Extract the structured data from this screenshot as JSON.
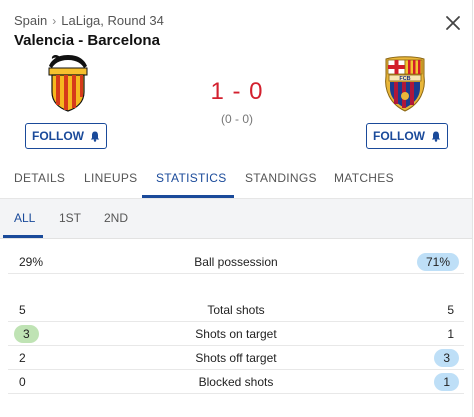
{
  "header": {
    "country": "Spain",
    "separator": "›",
    "competition": "LaLiga, Round 34",
    "title": "Valencia - Barcelona"
  },
  "match": {
    "home_team": "Valencia",
    "away_team": "Barcelona",
    "score": "1 - 0",
    "halftime": "(0 - 0)",
    "follow_label": "FOLLOW",
    "score_color": "#d3202e"
  },
  "tabs": [
    {
      "label": "DETAILS"
    },
    {
      "label": "LINEUPS"
    },
    {
      "label": "STATISTICS",
      "active": true
    },
    {
      "label": "STANDINGS"
    },
    {
      "label": "MATCHES"
    }
  ],
  "subtabs": [
    {
      "label": "ALL",
      "active": true
    },
    {
      "label": "1ST"
    },
    {
      "label": "2ND"
    }
  ],
  "stats": [
    {
      "label": "Ball possession",
      "home": "29%",
      "away": "71%",
      "leader": "away"
    },
    {
      "label": "Total shots",
      "home": "5",
      "away": "5",
      "leader": "none"
    },
    {
      "label": "Shots on target",
      "home": "3",
      "away": "1",
      "leader": "home"
    },
    {
      "label": "Shots off target",
      "home": "2",
      "away": "3",
      "leader": "away"
    },
    {
      "label": "Blocked shots",
      "home": "0",
      "away": "1",
      "leader": "away"
    }
  ],
  "colors": {
    "accent": "#1a4a9a",
    "home_highlight": "#bfe3b4",
    "away_highlight": "#bedff7"
  },
  "icons": {
    "close": "close-icon",
    "bell": "bell-icon",
    "home_crest": "valencia-crest-icon",
    "away_crest": "barcelona-crest-icon"
  }
}
